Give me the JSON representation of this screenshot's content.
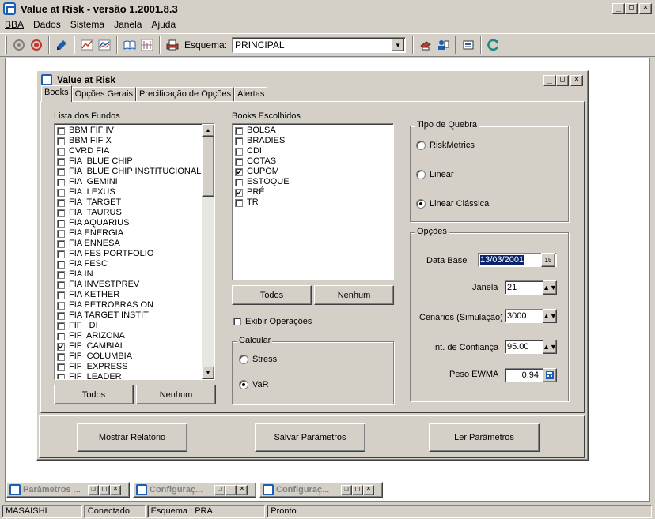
{
  "app": {
    "title": "Value at Risk - versão 1.2001.8.3",
    "window_buttons": [
      "_",
      "□",
      "×"
    ]
  },
  "menu": [
    "BBA",
    "Dados",
    "Sistema",
    "Janela",
    "Ajuda"
  ],
  "menu_underline": [
    "B",
    "D",
    "S",
    "J",
    "A"
  ],
  "toolbar": {
    "schema_label": "Esquema:",
    "schema_value": "PRINCIPAL",
    "icons": [
      "connect-icon",
      "disconnect-icon",
      "edit-icon",
      "chart-bars-icon",
      "chart-lines-icon",
      "book-icon",
      "report-chart-icon",
      "printer-icon",
      "schema-icon",
      "users-icon",
      "printer-setup-icon",
      "refresh-icon"
    ]
  },
  "child": {
    "title": "Value at Risk",
    "tabs": [
      "Books",
      "Opções Gerais",
      "Precificação de Opções",
      "Alertas"
    ]
  },
  "funds": {
    "label": "Lista dos Fundos",
    "items": [
      {
        "name": "BBM FIF IV",
        "checked": false
      },
      {
        "name": "BBM FIF X",
        "checked": false
      },
      {
        "name": "CVRD FIA",
        "checked": false
      },
      {
        "name": "FIA  BLUE CHIP",
        "checked": false
      },
      {
        "name": "FIA  BLUE CHIP INSTITUCIONAL",
        "checked": false
      },
      {
        "name": "FIA  GEMINI",
        "checked": false
      },
      {
        "name": "FIA  LEXUS",
        "checked": false
      },
      {
        "name": "FIA  TARGET",
        "checked": false
      },
      {
        "name": "FIA  TAURUS",
        "checked": false
      },
      {
        "name": "FIA AQUARIUS",
        "checked": false
      },
      {
        "name": "FIA ENERGIA",
        "checked": false
      },
      {
        "name": "FIA ENNESA",
        "checked": false
      },
      {
        "name": "FIA FES PORTFOLIO",
        "checked": false
      },
      {
        "name": "FIA FESC",
        "checked": false
      },
      {
        "name": "FIA IN",
        "checked": false
      },
      {
        "name": "FIA INVESTPREV",
        "checked": false
      },
      {
        "name": "FIA KETHER",
        "checked": false
      },
      {
        "name": "FIA PETROBRAS ON",
        "checked": false
      },
      {
        "name": "FIA TARGET INSTIT",
        "checked": false
      },
      {
        "name": "FIF   DI",
        "checked": false
      },
      {
        "name": "FIF  ARIZONA",
        "checked": false
      },
      {
        "name": "FIF  CAMBIAL",
        "checked": true
      },
      {
        "name": "FIF  COLUMBIA",
        "checked": false
      },
      {
        "name": "FIF  EXPRESS",
        "checked": false
      },
      {
        "name": "FIF  LEADER",
        "checked": false
      }
    ],
    "all_button": "Todos",
    "none_button": "Nenhum"
  },
  "books": {
    "label": "Books Escolhidos",
    "items": [
      {
        "name": "BOLSA",
        "checked": false
      },
      {
        "name": "BRADIES",
        "checked": false
      },
      {
        "name": "CDI",
        "checked": false
      },
      {
        "name": "COTAS",
        "checked": false
      },
      {
        "name": "CUPOM",
        "checked": true
      },
      {
        "name": "ESTOQUE",
        "checked": false
      },
      {
        "name": "PRÉ",
        "checked": true
      },
      {
        "name": "TR",
        "checked": false
      }
    ],
    "all_button": "Todos",
    "none_button": "Nenhum",
    "show_ops_label": "Exibir Operações",
    "show_ops_checked": false
  },
  "calcular": {
    "title": "Calcular",
    "options": [
      "Stress",
      "VaR"
    ],
    "selected": "VaR"
  },
  "tipo_quebra": {
    "title": "Tipo de Quebra",
    "options": [
      "RiskMetrics",
      "Linear",
      "Linear Clássica"
    ],
    "selected": "Linear Clássica"
  },
  "opcoes": {
    "title": "Opções",
    "data_base_label": "Data Base",
    "data_base_value": "13/03/2001",
    "calendar_icon_text": "15",
    "janela_label": "Janela",
    "janela_value": "21",
    "cenarios_label": "Cenários (Simulação)",
    "cenarios_value": "3000",
    "confianca_label": "Int. de Confiança",
    "confianca_value": "95.00",
    "ewma_label": "Peso EWMA",
    "ewma_value": "0.94"
  },
  "actions": {
    "report": "Mostrar Relatório",
    "save": "Salvar Parâmetros",
    "load": "Ler Parâmetros"
  },
  "minimized": [
    "Parâmetros ...",
    "Configuraç...",
    "Configuraç..."
  ],
  "status": {
    "user": "MASAISHI",
    "connection": "Conectado",
    "schema": "Esquema : PRA",
    "state": "Pronto"
  },
  "colors": {
    "face": "#d4d0c8",
    "selection": "#0a246a",
    "icon_blue": "#1a5fb4",
    "icon_red": "#c0392b"
  }
}
